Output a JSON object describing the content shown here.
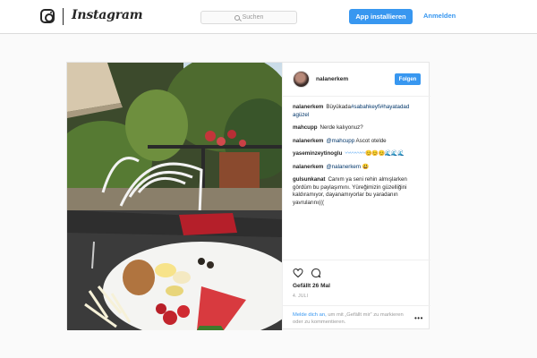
{
  "header": {
    "brand": "Instagram",
    "search": {
      "placeholder": "Suchen",
      "icon": "search-icon"
    },
    "install_label": "App installieren",
    "login_label": "Anmelden"
  },
  "post": {
    "owner": "nalanerkem",
    "follow_label": "Folgen",
    "caption": {
      "user": "nalanerkem",
      "text": "Büyükada",
      "tags": "#sabahkeyfi#hayatadad agüzel"
    },
    "comments": [
      {
        "user": "mahcupp",
        "text": "Nerde kalıyonuz?"
      },
      {
        "user": "nalanerkem",
        "mention": "@mahcupp",
        "text": " Ascot otelde"
      },
      {
        "user": "yaseminzeytinoglu",
        "emoji": "〰〰〰〰😊😊😊🌊🌊🌊"
      },
      {
        "user": "nalanerkem",
        "mention": "@nalanerkem",
        "emoji": " 😃"
      },
      {
        "user": "gulsunkanat",
        "text": "Canım ya seni rehin almışlarken gördüm bu paylaşımını. Yüreğimizin güzelliğini kaldıramıyor, dayanamıyorlar bu yaradanın yavrularını((("
      }
    ],
    "likes_text": "Gefällt 26 Mal",
    "date_text": "4. JULI",
    "login_prompt": {
      "link": "Melde dich an,",
      "text": " um mit „Gefällt mir“ zu markieren oder zu kommentieren."
    },
    "icons": {
      "like": "heart-icon",
      "comment": "comment-icon",
      "more": "more-icon"
    }
  },
  "colors": {
    "accent": "#3897f0",
    "background": "#fafafa",
    "border": "#dbdbdb",
    "text": "#262626",
    "muted": "#999999"
  }
}
